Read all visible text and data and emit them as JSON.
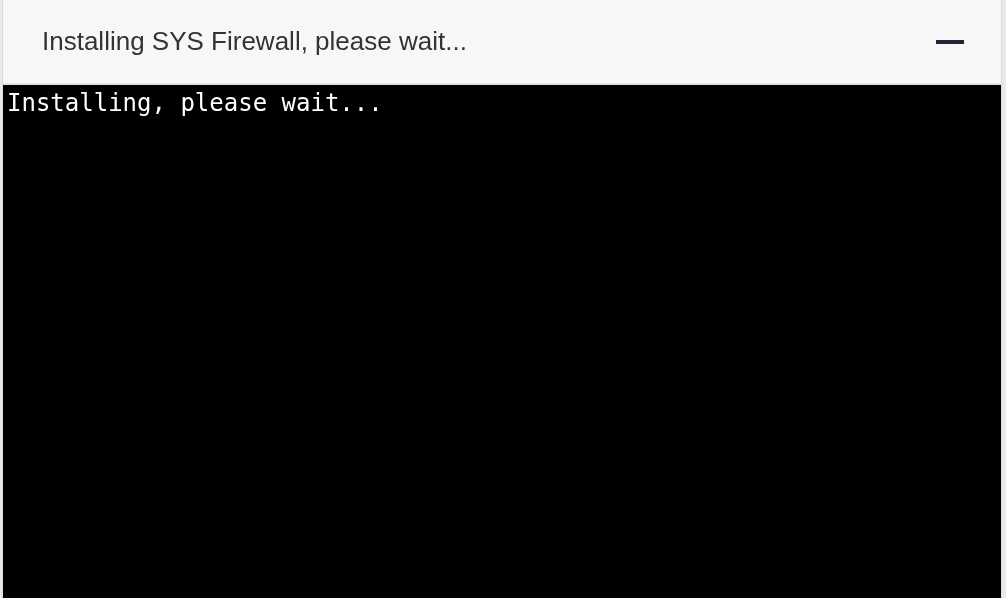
{
  "window": {
    "title": "Installing SYS Firewall, please wait..."
  },
  "terminal": {
    "lines": [
      "Installing, please wait..."
    ]
  }
}
